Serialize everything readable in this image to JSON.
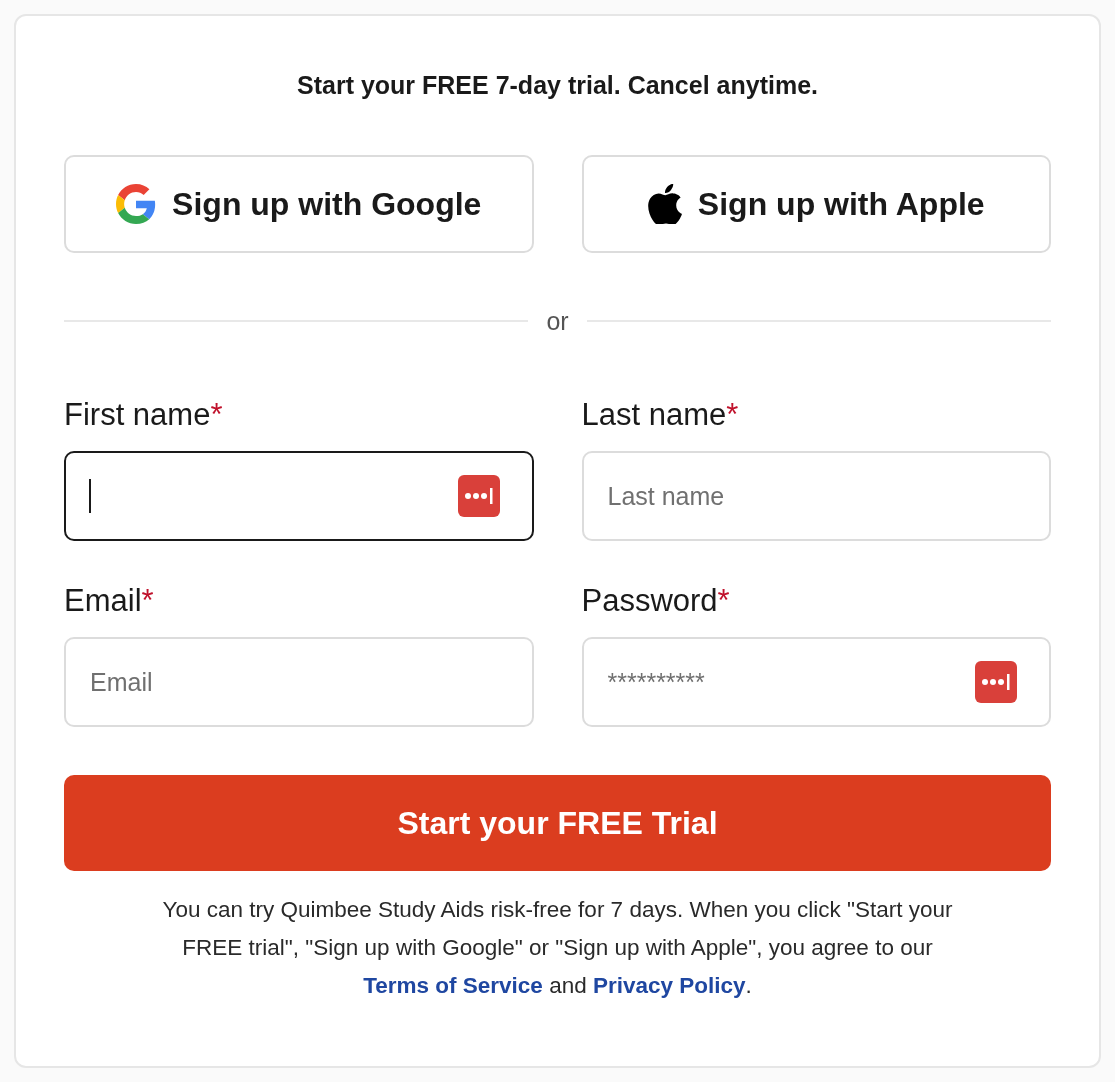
{
  "heading": "Start your FREE 7-day trial. Cancel anytime.",
  "social_buttons": [
    {
      "kind": "google",
      "label": "Sign up with Google"
    },
    {
      "kind": "apple",
      "label": "Sign up with Apple"
    }
  ],
  "divider": "or",
  "fields": [
    {
      "label": "First name",
      "required_mark": "*",
      "focused": true,
      "autofill_icon": true
    },
    {
      "label": "Last name",
      "required_mark": "*",
      "placeholder": "Last name",
      "focused": false,
      "autofill_icon": false
    },
    {
      "label": "Email",
      "required_mark": "*",
      "placeholder": "Email",
      "focused": false,
      "autofill_icon": false
    },
    {
      "label": "Password",
      "required_mark": "*",
      "value": "**********",
      "focused": false,
      "autofill_icon": true
    }
  ],
  "submit": "Start your FREE Trial",
  "legal": [
    {
      "kind": "text",
      "text": "You can try Quimbee Study Aids risk-free for 7 days. When you click \"Start your FREE trial\", \"Sign up with Google\" or \"Sign up with Apple\", you agree to our "
    },
    {
      "kind": "link",
      "text": "Terms of Service"
    },
    {
      "kind": "text",
      "text": " and "
    },
    {
      "kind": "link",
      "text": "Privacy Policy"
    },
    {
      "kind": "text",
      "text": "."
    }
  ]
}
